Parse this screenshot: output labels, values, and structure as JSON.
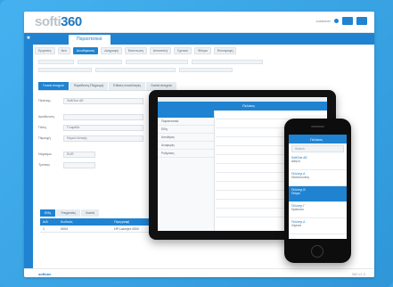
{
  "app": {
    "logo_text": "softi",
    "logo_number": "360",
    "user_name": "customer",
    "active_tab": "Παραστατικά"
  },
  "toolbar": {
    "items": [
      "Εργασίες",
      "Νέο",
      "Αποθήκευση",
      "Διαγραφή",
      "Εκτύπωση",
      "Αποστολή",
      "Σχετικά",
      "Φίλτρα",
      "Επιστροφή"
    ]
  },
  "subtabs": [
    "Γενικά στοιχεία",
    "Παράδοση-Πληρωμή",
    "Ειδικές συναλλαγές",
    "Λοιπά στοιχεία"
  ],
  "detail": {
    "rows": [
      {
        "label": "Πελάτης",
        "value": "SoftOne AE"
      },
      {
        "label": "Διεύθυνση",
        "value": ""
      },
      {
        "label": "Πόλη",
        "value": "Γλυφάδα"
      },
      {
        "label": "Περιοχή",
        "value": "Νομού Αττικής"
      }
    ],
    "currency_label": "Νόμισμα",
    "currency_value": "EUR",
    "payment_label": "Τρόπος"
  },
  "lines": {
    "tabs": [
      "Είδη",
      "Υπηρεσίες",
      "Λοιπά"
    ],
    "headers": [
      "Α/Α",
      "Κωδικός",
      "Περιγραφή"
    ],
    "rows": [
      {
        "no": "1",
        "code": "0004",
        "desc": "HP Laserjet 4300"
      }
    ]
  },
  "footer": {
    "brand": "softone",
    "version": "360 v1.0"
  },
  "tablet": {
    "title": "Πελάτες",
    "side_items": [
      "Πελάτες",
      "Παραστατικά",
      "Είδη",
      "Αποθήκες",
      "Αναφορές",
      "Ρυθμίσεις"
    ]
  },
  "phone": {
    "title": "Πελάτες",
    "search_placeholder": "Search",
    "items": [
      {
        "t1": "SoftOne AE",
        "t2": "Αθήνα"
      },
      {
        "t1": "Πελάτης Α",
        "t2": "Θεσσαλονίκη"
      },
      {
        "t1": "Πελάτης Β",
        "t2": "Πάτρα"
      },
      {
        "t1": "Πελάτης Γ",
        "t2": "Ηράκλειο"
      },
      {
        "t1": "Πελάτης Δ",
        "t2": "Λάρισα"
      }
    ],
    "highlight_index": 2
  },
  "colors": {
    "background": "#3aa3e3",
    "accent": "#1f83d1",
    "logo_number": "#1f78bd"
  }
}
